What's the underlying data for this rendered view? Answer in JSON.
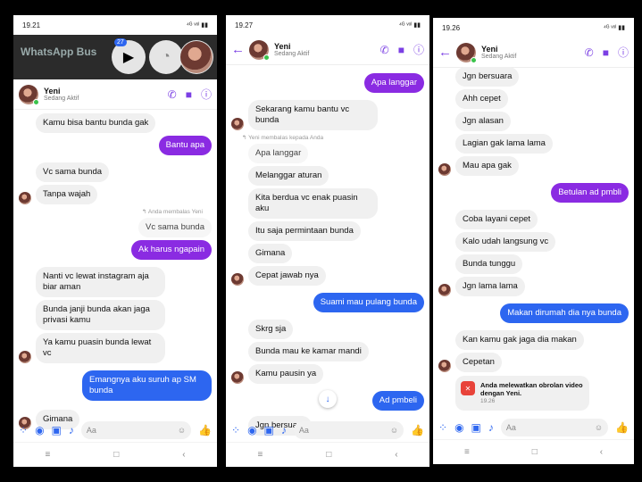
{
  "p1": {
    "time": "19.21",
    "status_right": "⁴ᴳ ᵛᵒˡ ▮▮",
    "wa_title": "WhatsApp Bus",
    "messenger_badge": "27",
    "contact_name": "Yeni",
    "contact_status": "Sedang Aktif",
    "messages": [
      {
        "dir": "in",
        "text": "Kamu bisa bantu bunda gak",
        "avatar": false
      },
      {
        "dir": "out",
        "text": "Bantu apa",
        "style": "purple"
      },
      {
        "dir": "in",
        "text": "Vc sama bunda",
        "avatar": false
      },
      {
        "dir": "in",
        "text": "Tanpa wajah",
        "avatar": true
      }
    ],
    "reply_note": "↰ Anda membalas Yeni",
    "quoted": "Vc sama bunda",
    "messages2": [
      {
        "dir": "out",
        "text": "Ak harus ngapain",
        "style": "purple"
      },
      {
        "dir": "in",
        "text": "Nanti vc lewat instagram aja biar aman",
        "avatar": false
      },
      {
        "dir": "in",
        "text": "Bunda janji bunda akan jaga privasi kamu",
        "avatar": false
      },
      {
        "dir": "in",
        "text": "Ya kamu puasin bunda lewat vc",
        "avatar": true
      },
      {
        "dir": "out",
        "text": "Emangnya aku suruh ap SM bunda",
        "style": "blue"
      },
      {
        "dir": "in",
        "text": "Gimana",
        "avatar": true
      }
    ],
    "composer_placeholder": "Aa"
  },
  "p2": {
    "time": "19.27",
    "status_right": "⁴ᴳ ᵛᵒˡ ▮▮",
    "contact_name": "Yeni",
    "contact_status": "Sedang Aktif",
    "messages": [
      {
        "dir": "out",
        "text": "Apa langgar",
        "style": "purple"
      },
      {
        "dir": "in",
        "text": "Sekarang kamu bantu vc bunda",
        "avatar": true
      }
    ],
    "reply_note": "↰ Yeni membalas kepada Anda",
    "quoted": "Apa langgar",
    "messages2": [
      {
        "dir": "in",
        "text": "Melanggar aturan",
        "avatar": false
      },
      {
        "dir": "in",
        "text": "Kita berdua vc enak puasin aku",
        "avatar": false
      },
      {
        "dir": "in",
        "text": "Itu saja permintaan bunda",
        "avatar": false
      },
      {
        "dir": "in",
        "text": "Gimana",
        "avatar": false
      },
      {
        "dir": "in",
        "text": "Cepat jawab nya",
        "avatar": true
      },
      {
        "dir": "out",
        "text": "Suami mau pulang bunda",
        "style": "blue"
      },
      {
        "dir": "in",
        "text": "Skrg sja",
        "avatar": false
      },
      {
        "dir": "in",
        "text": "Bunda mau ke kamar mandi",
        "avatar": false
      },
      {
        "dir": "in",
        "text": "Kamu pausin ya",
        "avatar": true
      },
      {
        "dir": "out",
        "text": "Ad pmbeli",
        "style": "blue"
      },
      {
        "dir": "in",
        "text": "Jgn bersuara",
        "avatar": false
      }
    ],
    "composer_placeholder": "Aa"
  },
  "p3": {
    "time": "19.26",
    "status_right": "⁴ᴳ ᵛᵒˡ ▮▮",
    "contact_name": "Yeni",
    "contact_status": "Sedang Aktif",
    "messages": [
      {
        "dir": "in",
        "text": "Jgn bersuara",
        "avatar": false
      },
      {
        "dir": "in",
        "text": "Ahh cepet",
        "avatar": false
      },
      {
        "dir": "in",
        "text": "Jgn alasan",
        "avatar": false
      },
      {
        "dir": "in",
        "text": "Lagian gak lama lama",
        "avatar": false
      },
      {
        "dir": "in",
        "text": "Mau apa gak",
        "avatar": true
      },
      {
        "dir": "out",
        "text": "Betulan ad pmbli",
        "style": "purple"
      },
      {
        "dir": "in",
        "text": "Coba layani cepet",
        "avatar": false
      },
      {
        "dir": "in",
        "text": "Kalo udah langsung vc",
        "avatar": false
      },
      {
        "dir": "in",
        "text": "Bunda tunggu",
        "avatar": false
      },
      {
        "dir": "in",
        "text": "Jgn lama lama",
        "avatar": true
      },
      {
        "dir": "out",
        "text": "Makan dirumah dia nya bunda",
        "style": "blue"
      },
      {
        "dir": "in",
        "text": "Kan kamu gak jaga dia makan",
        "avatar": false
      },
      {
        "dir": "in",
        "text": "Cepetan",
        "avatar": true
      }
    ],
    "missed_call_text": "Anda melewatkan obrolan video dengan Yeni.",
    "missed_call_time": "19.26",
    "composer_placeholder": "Aa"
  }
}
